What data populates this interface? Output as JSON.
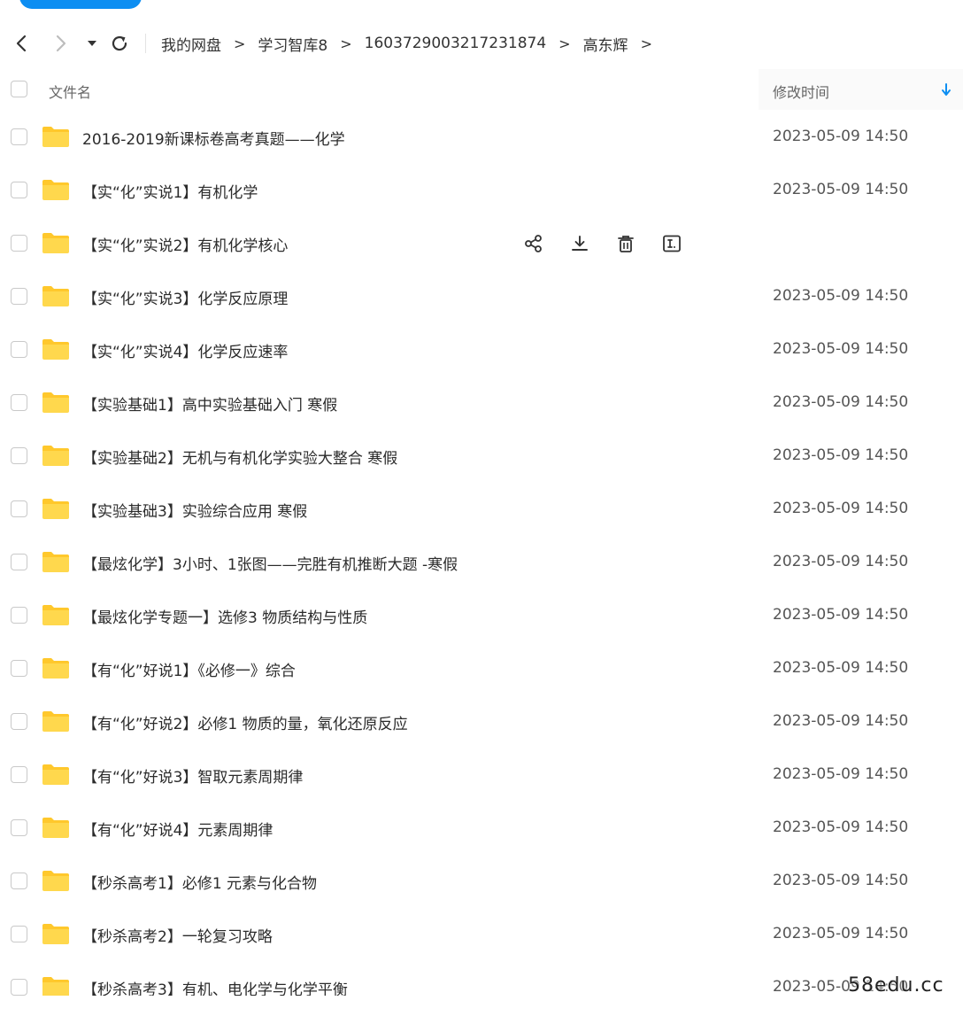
{
  "navbar": {
    "breadcrumb": [
      {
        "label": "我的网盘"
      },
      {
        "label": "学习智库8"
      },
      {
        "label": "1603729003217231874"
      },
      {
        "label": "高东辉"
      }
    ],
    "separator": ">"
  },
  "header": {
    "name_label": "文件名",
    "time_label": "修改时间"
  },
  "files": [
    {
      "name": "2016-2019新课标卷高考真题——化学",
      "time": "2023-05-09 14:50"
    },
    {
      "name": "【实“化”实说1】有机化学",
      "time": "2023-05-09 14:50"
    },
    {
      "name": "【实“化”实说2】有机化学核心",
      "time": ""
    },
    {
      "name": "【实“化”实说3】化学反应原理",
      "time": "2023-05-09 14:50"
    },
    {
      "name": "【实“化”实说4】化学反应速率",
      "time": "2023-05-09 14:50"
    },
    {
      "name": "【实验基础1】高中实验基础入门 寒假",
      "time": "2023-05-09 14:50"
    },
    {
      "name": "【实验基础2】无机与有机化学实验大整合 寒假",
      "time": "2023-05-09 14:50"
    },
    {
      "name": "【实验基础3】实验综合应用 寒假",
      "time": "2023-05-09 14:50"
    },
    {
      "name": "【最炫化学】3小时、1张图——完胜有机推断大题 -寒假",
      "time": "2023-05-09 14:50"
    },
    {
      "name": "【最炫化学专题一】选修3 物质结构与性质",
      "time": "2023-05-09 14:50"
    },
    {
      "name": "【有“化”好说1】《必修一》综合",
      "time": "2023-05-09 14:50"
    },
    {
      "name": "【有“化”好说2】必修1 物质的量，氧化还原反应",
      "time": "2023-05-09 14:50"
    },
    {
      "name": "【有“化”好说3】智取元素周期律",
      "time": "2023-05-09 14:50"
    },
    {
      "name": "【有“化”好说4】元素周期律",
      "time": "2023-05-09 14:50"
    },
    {
      "name": "【秒杀高考1】必修1 元素与化合物",
      "time": "2023-05-09 14:50"
    },
    {
      "name": "【秒杀高考2】一轮复习攻略",
      "time": "2023-05-09 14:50"
    },
    {
      "name": "【秒杀高考3】有机、电化学与化学平衡",
      "time": "2023-05-09 14:50"
    }
  ],
  "hover_row_index": 2,
  "watermark": "58edu.cc",
  "colors": {
    "accent": "#0d8ef2",
    "folder": "#ffd84d",
    "folder_tab": "#ffc82c"
  }
}
